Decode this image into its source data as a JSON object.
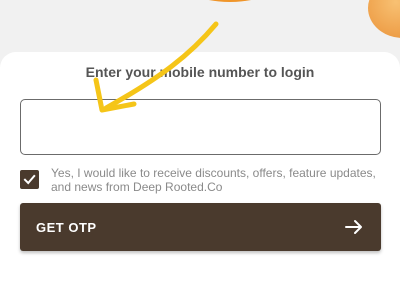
{
  "login": {
    "heading": "Enter your mobile number to login",
    "phone_value": "",
    "consent_checked": true,
    "consent_text": "Yes, I would like to receive discounts, offers, feature updates, and news from Deep Rooted.Co",
    "otp_button_label": "GET OTP",
    "otp_button_icon": "arrow-right-icon"
  },
  "colors": {
    "brand_brown": "#4a3a2d",
    "annotation_arrow": "#f5c518",
    "orange": "#f29a2e"
  },
  "annotation": {
    "icon": "pointing-arrow-icon"
  }
}
